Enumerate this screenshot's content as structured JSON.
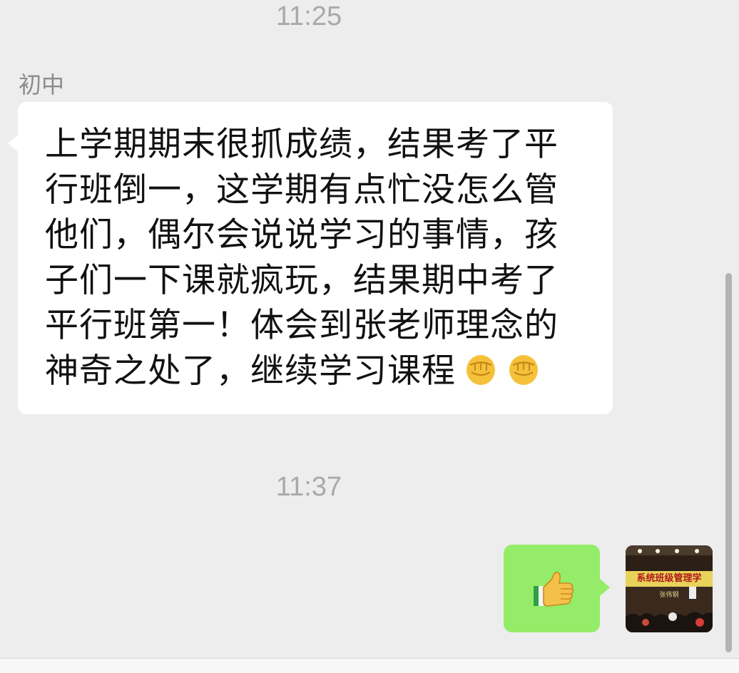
{
  "chat": {
    "timestamps": [
      "11:25",
      "11:37"
    ],
    "incoming": {
      "sender_name": "初中",
      "text": "上学期期末很抓成绩，结果考了平行班倒一，这学期有点忙没怎么管他们，偶尔会说说学习的事情，孩子们一下课就疯玩，结果期中考了平行班第一！体会到张老师理念的神奇之处了，继续学习课程",
      "emoji": [
        "fist-emoji",
        "fist-emoji"
      ]
    },
    "outgoing": {
      "emoji": "thumbs-up-emoji"
    },
    "avatar": {
      "banner": "系统班级管理学",
      "sub": "张伟钢"
    }
  },
  "colors": {
    "background": "#ededed",
    "incoming_bubble": "#ffffff",
    "outgoing_bubble": "#95ec69",
    "timestamp": "#a9a9a9",
    "sender_name": "#8c8c8c"
  }
}
